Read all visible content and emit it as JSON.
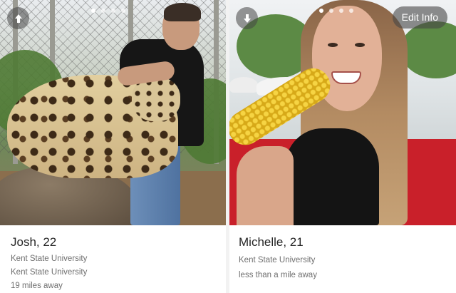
{
  "profiles": [
    {
      "name_age": "Josh, 22",
      "lines": [
        "Kent State University",
        "Kent State University",
        "19 miles away"
      ],
      "photo_dots": 4,
      "active_dot": 0,
      "nav_icon": "arrow-up-icon"
    },
    {
      "name_age": "Michelle, 21",
      "lines": [
        "Kent State University",
        "less than a mile away"
      ],
      "photo_dots": 4,
      "active_dot": 0,
      "nav_icon": "arrow-down-icon",
      "edit_label": "Edit Info"
    }
  ],
  "colors": {
    "overlay": "#464646",
    "name_text": "#262626",
    "secondary_text": "#6f6f6f"
  }
}
